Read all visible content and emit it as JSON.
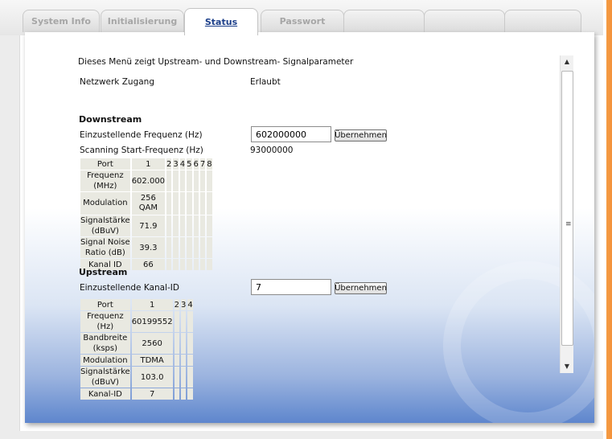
{
  "tabs": [
    {
      "label": "System Info"
    },
    {
      "label": "Initialisierung"
    },
    {
      "label": "Status"
    },
    {
      "label": "Passwort"
    },
    {
      "label": ""
    },
    {
      "label": ""
    },
    {
      "label": ""
    }
  ],
  "intro": "Dieses Menü zeigt Upstream- und Downstream- Signalparameter",
  "network": {
    "label": "Netzwerk Zugang",
    "value": "Erlaubt"
  },
  "downstream": {
    "heading": "Downstream",
    "freq_label": "Einzustellende Frequenz (Hz)",
    "freq_value": "602000000",
    "apply_label": "Übernehmen",
    "scan_label": "Scanning Start-Frequenz (Hz)",
    "scan_value": "93000000",
    "header": [
      "Port",
      "1",
      "2",
      "3",
      "4",
      "5",
      "6",
      "7",
      "8"
    ],
    "rows": [
      [
        "Frequenz (MHz)",
        "602.000",
        "",
        "",
        "",
        "",
        "",
        "",
        ""
      ],
      [
        "Modulation",
        "256 QAM",
        "",
        "",
        "",
        "",
        "",
        "",
        ""
      ],
      [
        "Signalstärke (dBuV)",
        "71.9",
        "",
        "",
        "",
        "",
        "",
        "",
        ""
      ],
      [
        "Signal Noise Ratio (dB)",
        "39.3",
        "",
        "",
        "",
        "",
        "",
        "",
        ""
      ],
      [
        "Kanal ID",
        "66",
        "",
        "",
        "",
        "",
        "",
        "",
        ""
      ]
    ]
  },
  "upstream": {
    "heading": "Upstream",
    "channel_label": "Einzustellende Kanal-ID",
    "channel_value": "7",
    "apply_label": "Übernehmen",
    "header": [
      "Port",
      "1",
      "2",
      "3",
      "4"
    ],
    "rows": [
      [
        "Frequenz (Hz)",
        "60199552",
        "",
        "",
        ""
      ],
      [
        "Bandbreite (ksps)",
        "2560",
        "",
        "",
        ""
      ],
      [
        "Modulation",
        "TDMA",
        "",
        "",
        ""
      ],
      [
        "Signalstärke (dBuV)",
        "103.0",
        "",
        "",
        ""
      ],
      [
        "Kanal-ID",
        "7",
        "",
        "",
        ""
      ]
    ]
  },
  "icons": {
    "scroll_up": "arrow-up-icon",
    "scroll_down": "arrow-down-icon",
    "grip": "scroll-grip-icon"
  }
}
